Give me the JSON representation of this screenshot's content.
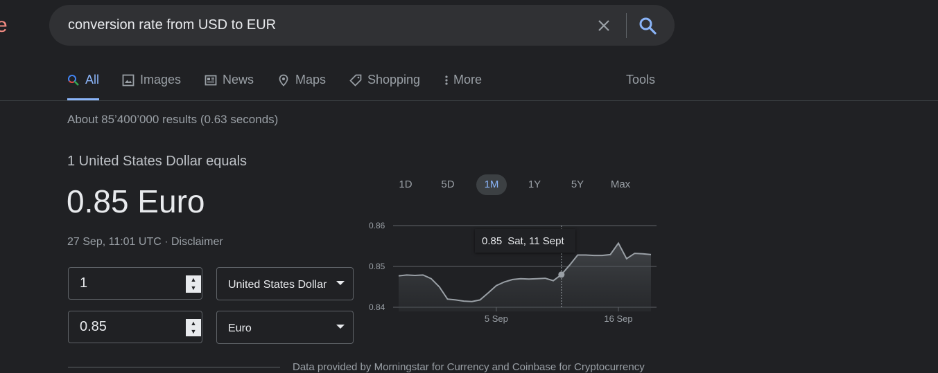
{
  "search": {
    "query": "conversion rate from USD to EUR"
  },
  "logo_fragment": "e",
  "tabs": [
    {
      "label": "All",
      "icon": "search-icon",
      "active": true
    },
    {
      "label": "Images",
      "icon": "image-icon",
      "active": false
    },
    {
      "label": "News",
      "icon": "news-icon",
      "active": false
    },
    {
      "label": "Maps",
      "icon": "map-pin-icon",
      "active": false
    },
    {
      "label": "Shopping",
      "icon": "tag-icon",
      "active": false
    },
    {
      "label": "More",
      "icon": "more-vert-icon",
      "active": false
    }
  ],
  "tools_label": "Tools",
  "results_stats": "About 85’400’000 results (0.63 seconds)",
  "converter": {
    "equals_line": "1 United States Dollar equals",
    "rate_display": "0.85 Euro",
    "timestamp": "27 Sep, 11:01 UTC · Disclaimer",
    "amount_from": "1",
    "currency_from": "United States Dollar",
    "amount_to": "0.85",
    "currency_to": "Euro"
  },
  "ranges": [
    "1D",
    "5D",
    "1M",
    "1Y",
    "5Y",
    "Max"
  ],
  "active_range": "1M",
  "tooltip": {
    "value": "0.85",
    "date": "Sat, 11 Sept"
  },
  "footer_note": "Data provided by Morningstar for Currency and Coinbase for Cryptocurrency",
  "colors": {
    "accent": "#8ab4f8",
    "background": "#202124",
    "line": "#9aa0a6"
  },
  "chart_data": {
    "type": "area",
    "y_ticks": [
      0.84,
      0.85,
      0.86
    ],
    "ylim": [
      0.84,
      0.86
    ],
    "x_tick_labels": [
      {
        "label": "5 Sep",
        "index": 12
      },
      {
        "label": "16 Sep",
        "index": 27
      }
    ],
    "values": [
      0.8477,
      0.8479,
      0.8478,
      0.8479,
      0.847,
      0.845,
      0.842,
      0.8418,
      0.8415,
      0.8414,
      0.8418,
      0.8435,
      0.8453,
      0.8462,
      0.8468,
      0.847,
      0.8469,
      0.847,
      0.8471,
      0.8465,
      0.848,
      0.8503,
      0.8528,
      0.8528,
      0.8527,
      0.8527,
      0.8529,
      0.8557,
      0.8519,
      0.8532,
      0.8531,
      0.8529
    ],
    "highlight_index": 20
  }
}
